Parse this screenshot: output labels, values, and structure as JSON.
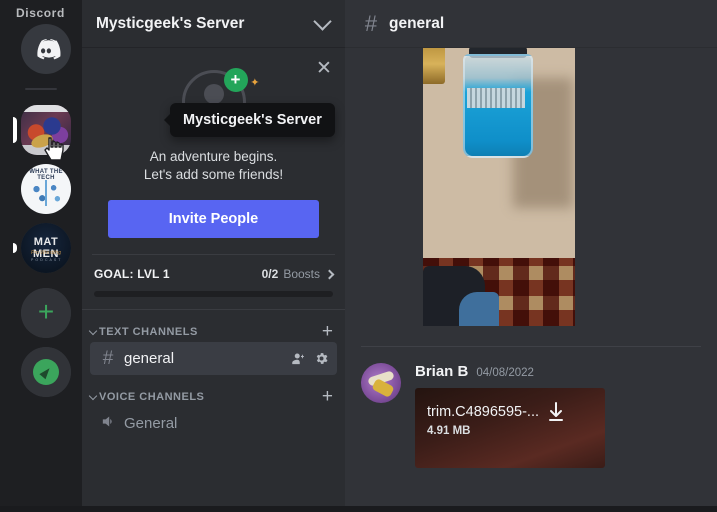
{
  "brand": {
    "label": "Discord"
  },
  "rail": {
    "home_icon": "discord-logo-icon",
    "servers": [
      {
        "name": "Mysticgeek's Server",
        "art": "art1",
        "active": true
      },
      {
        "name": "What The Tech Podcast",
        "art": "art2",
        "line1": "WHAT THE TECH",
        "active": false
      },
      {
        "name": "Mat Men Pro Wrestling Podcast",
        "art": "art3",
        "line1": "MAT MEN",
        "line2": "Pro Wrestling",
        "line3": "P O D C A S T",
        "active": false
      }
    ],
    "add_server": {
      "label": "+",
      "name": "add-a-server-button"
    },
    "explore": {
      "name": "explore-public-servers-button"
    }
  },
  "sidebar": {
    "server_name": "Mysticgeek's Server",
    "tooltip": "Mysticgeek's Server",
    "close_label": "✕",
    "welcome": {
      "line1": "An adventure begins.",
      "line2": "Let's add some friends!",
      "badge": "+",
      "sparkle": "✦"
    },
    "invite_button": "Invite People",
    "boost": {
      "goal": "GOAL: LVL 1",
      "count": "0/2",
      "label": "Boosts",
      "progress_percent": 0
    },
    "categories": [
      {
        "title": "TEXT CHANNELS",
        "add_label": "+",
        "channels": [
          {
            "name": "general",
            "type": "text",
            "selected": true,
            "actions": [
              "create-invite-icon",
              "edit-channel-icon"
            ]
          }
        ]
      },
      {
        "title": "VOICE CHANNELS",
        "add_label": "+",
        "channels": [
          {
            "name": "General",
            "type": "voice",
            "selected": false
          }
        ]
      }
    ]
  },
  "main": {
    "channel_title": "general",
    "channel_hash": "#",
    "messages": [
      {
        "type": "image-attachment",
        "alt": "photo of a blue sports drink bottle on a wooden table"
      },
      {
        "type": "file-attachment",
        "author": "Brian B",
        "timestamp": "04/08/2022",
        "file_name": "trim.C4896595-...",
        "file_size": "4.91 MB",
        "download_label": "download-icon"
      }
    ]
  },
  "colors": {
    "brand_blurple": "#5865f2",
    "green_accent": "#3ba55c",
    "sidebar_bg": "#2b2d31",
    "chat_bg": "#313338",
    "rail_bg": "#1e1f22",
    "text_primary": "#f2f3f5",
    "text_muted": "#949ba4"
  }
}
